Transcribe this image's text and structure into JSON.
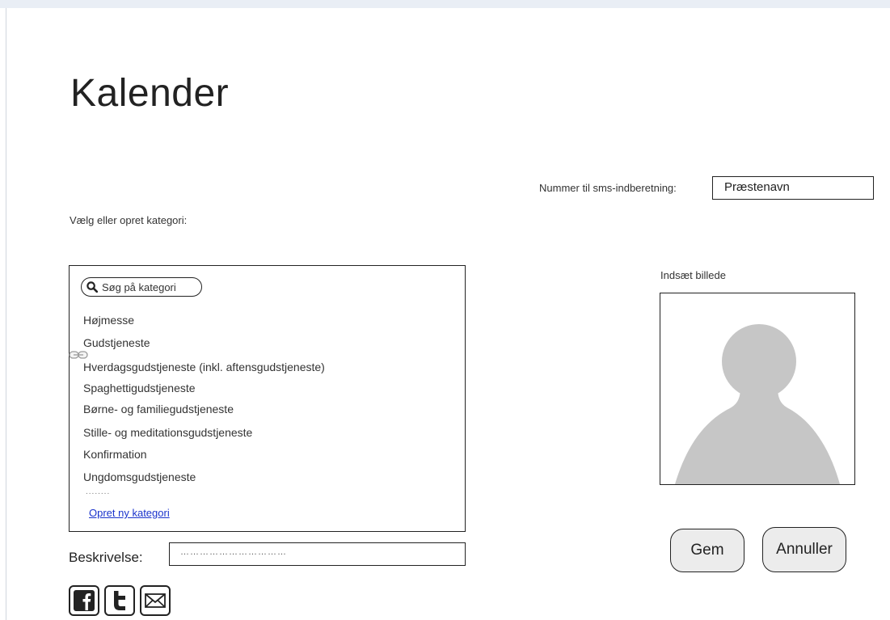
{
  "page": {
    "title": "Kalender"
  },
  "sms": {
    "label": "Nummer til sms-indberetning:",
    "value": "Præstenavn"
  },
  "category": {
    "label": "Vælg eller opret kategori:",
    "search_placeholder": "Søg på kategori",
    "items": [
      "Højmesse",
      "Gudstjeneste",
      "Hverdagsgudstjeneste (inkl. aftensgudstjeneste)",
      "Spaghettigudstjeneste",
      "Børne- og familiegudstjeneste",
      "Stille- og meditationsgudstjeneste",
      "Konfirmation",
      "Ungdomsgudstjeneste"
    ],
    "more": "........",
    "new_link": "Opret ny kategori"
  },
  "description": {
    "label": "Beskrivelse:",
    "value": "……………………………"
  },
  "image": {
    "label": "Indsæt billede"
  },
  "buttons": {
    "save": "Gem",
    "cancel": "Annuller"
  },
  "social": {
    "facebook": "facebook-icon",
    "twitter": "twitter-icon",
    "email": "email-icon"
  }
}
